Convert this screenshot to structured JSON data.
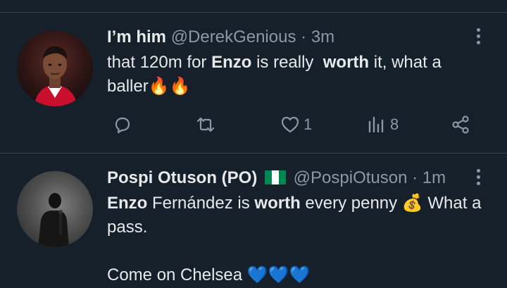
{
  "tweets": [
    {
      "display_name": "I’m him",
      "handle": "@DerekGenious",
      "separator": "·",
      "time": "3m",
      "text": {
        "line1_pre": "that 120m for ",
        "line1_b1": "Enzo",
        "line1_mid": " is really  ",
        "line1_b2": "worth",
        "line1_post": " it, what a",
        "line2": "baller",
        "emoji": "🔥🔥"
      },
      "actions": {
        "reply": "",
        "retweet": "",
        "like": "1",
        "views": "8"
      }
    },
    {
      "display_name": "Pospi Otuson (PO)",
      "handle": "@PospiOtuson",
      "separator": "·",
      "time": "1m",
      "text": {
        "line1_b1": "Enzo",
        "line1_mid": " Fernández is ",
        "line1_b2": "worth",
        "line1_post": " every penny ",
        "money_emoji": "💰",
        "line1_end": " What a",
        "line2": "pass.",
        "line3": "Come on Chelsea ",
        "hearts": "💙💙💙"
      }
    }
  ],
  "colors": {
    "background": "#15202b",
    "text": "#e7e9ea",
    "secondary": "#8b98a5",
    "divider": "#38444d"
  }
}
